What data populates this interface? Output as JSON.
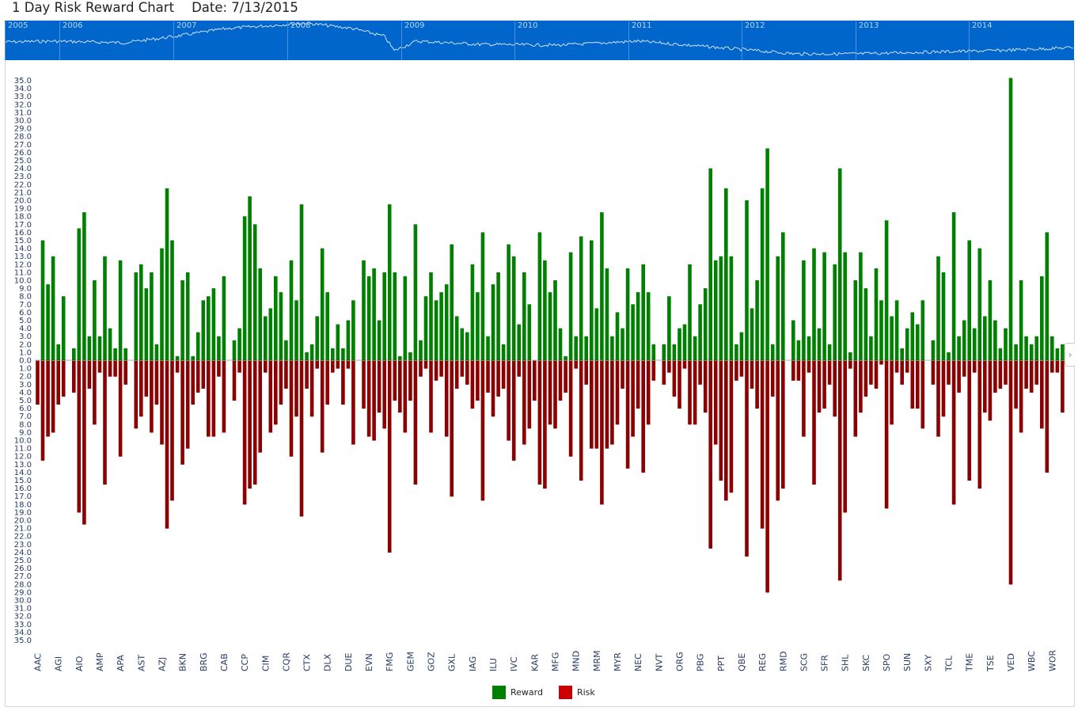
{
  "header": {
    "title": "1 Day Risk Reward Chart",
    "date_label": "Date: 7/13/2015"
  },
  "navigator": {
    "years": [
      "2005",
      "2006",
      "2007",
      "2008",
      "2009",
      "2010",
      "2011",
      "2012",
      "2013",
      "2014"
    ],
    "background_color": "#0066cc"
  },
  "colors": {
    "reward": "#008000",
    "risk": "#8b0000",
    "risk_legend": "#cc0000",
    "zero_line": "#cccccc"
  },
  "chart_data": {
    "type": "bar",
    "ylim": [
      -35,
      35
    ],
    "y_tick_step": 1,
    "y_tick_labels_absolute": true,
    "grid": false,
    "legend_position": "bottom",
    "x_tick_labels": [
      "AAC",
      "AGI",
      "AIO",
      "AMP",
      "APA",
      "AST",
      "AZJ",
      "BKN",
      "BRG",
      "CAB",
      "CCP",
      "CIM",
      "CQR",
      "CTX",
      "DLX",
      "DUE",
      "EVN",
      "FMG",
      "GEM",
      "GOZ",
      "GXL",
      "IAG",
      "ILU",
      "IVC",
      "KAR",
      "MFG",
      "MND",
      "MRM",
      "MYR",
      "NEC",
      "NVT",
      "ORG",
      "PBG",
      "PPT",
      "QBE",
      "REG",
      "RMD",
      "SCG",
      "SFR",
      "SHL",
      "SKC",
      "SPO",
      "SUN",
      "SXY",
      "TCL",
      "TME",
      "TSE",
      "VED",
      "WBC",
      "WOR"
    ],
    "series": [
      {
        "name": "Reward",
        "direction": "up",
        "values": [
          0,
          15,
          9.5,
          13,
          2,
          8,
          0,
          1.5,
          16.5,
          18.5,
          3,
          10,
          3,
          13,
          4,
          1.5,
          12.5,
          1.5,
          0,
          11,
          12,
          9,
          11,
          2,
          14,
          21.5,
          15,
          0.5,
          10,
          11,
          0.5,
          3.5,
          7.5,
          8,
          9,
          3,
          10.5,
          0,
          2.5,
          4,
          18,
          20.5,
          17,
          11.5,
          5.5,
          6.5,
          10.5,
          8.5,
          2.5,
          12.5,
          7.5,
          19.5,
          1,
          2,
          5.5,
          14,
          8.5,
          1.5,
          4.5,
          1.5,
          5,
          7.5,
          0,
          12.5,
          10.5,
          11.5,
          5,
          11,
          19.5,
          11,
          0.5,
          10.5,
          1,
          17,
          2.5,
          8,
          11,
          7.5,
          8.5,
          9.5,
          14.5,
          5.5,
          4,
          3.5,
          12,
          8.5,
          16,
          3,
          9.5,
          11,
          2,
          14.5,
          13,
          4.5,
          11,
          7,
          0,
          16,
          12.5,
          8.5,
          10,
          4,
          0.5,
          13.5,
          3,
          15.5,
          3,
          15,
          6.5,
          18.5,
          11.5,
          3,
          6,
          4,
          11.5,
          7,
          8.5,
          12,
          8.5,
          2,
          0,
          2,
          8,
          2,
          4,
          4.5,
          12,
          3,
          7,
          9,
          24,
          12.5,
          13,
          21.5,
          13,
          2,
          3.5,
          20,
          6.5,
          10,
          21.5,
          26.5,
          2,
          13,
          16,
          0,
          5,
          2.5,
          12.5,
          3,
          14,
          4,
          13.5,
          2,
          12,
          24,
          13.5,
          1,
          10,
          13.5,
          9,
          3,
          11.5,
          7.5,
          17.5,
          5.5,
          7.5,
          1.5,
          4,
          6,
          4.5,
          7.5,
          0,
          2.5,
          13,
          11,
          1,
          18.5,
          3,
          5,
          15,
          4,
          14,
          5.5,
          10,
          5,
          1.5,
          4,
          35.3,
          2,
          10,
          3,
          2,
          3,
          10.5,
          16,
          3,
          1.5,
          2
        ]
      },
      {
        "name": "Risk",
        "direction": "down",
        "values": [
          5.5,
          12.5,
          9.5,
          9,
          5.5,
          4.5,
          0,
          4,
          19,
          20.5,
          3.5,
          8,
          1.5,
          15.5,
          2,
          2,
          12,
          3,
          0,
          8.5,
          7,
          4.5,
          9,
          5.5,
          10.5,
          21,
          17.5,
          1.5,
          13,
          11,
          5.5,
          4,
          3.5,
          9.5,
          9.5,
          2,
          9,
          0,
          5,
          1.5,
          18,
          16,
          15.5,
          11.5,
          1.5,
          9,
          8,
          5.5,
          3.5,
          12,
          7,
          19.5,
          3.5,
          7,
          1,
          11.5,
          5.5,
          1.5,
          1,
          5.5,
          1,
          10.5,
          0,
          6,
          9.5,
          10,
          6.5,
          8.5,
          24,
          5,
          6.5,
          9,
          5,
          15.5,
          2,
          1,
          9,
          2.5,
          2,
          9.5,
          17,
          3.5,
          2,
          3,
          6,
          5,
          17.5,
          4,
          7,
          4.5,
          3.5,
          10,
          12.5,
          2,
          10.5,
          8.5,
          5,
          15.5,
          16,
          8,
          8.5,
          5,
          4,
          12,
          1,
          15,
          3,
          11,
          11,
          18,
          11,
          10.5,
          8,
          3.5,
          13.5,
          9.5,
          6,
          14,
          8,
          2.5,
          0,
          3,
          1.5,
          4.5,
          6,
          1,
          8,
          8,
          3,
          6.5,
          23.5,
          10.5,
          15,
          17.5,
          16.5,
          2.5,
          2,
          24.5,
          3.5,
          6,
          21,
          29,
          4.5,
          17.5,
          16,
          0,
          2.5,
          2.5,
          9.5,
          1.5,
          15.5,
          6.5,
          6,
          3,
          7,
          27.5,
          19,
          1,
          9.5,
          6.5,
          4.5,
          3,
          3.5,
          0.5,
          18.5,
          8,
          1.5,
          3,
          1.5,
          6,
          6,
          8.5,
          0,
          3,
          9.5,
          7,
          3,
          18,
          4,
          2,
          15,
          1.5,
          16,
          6.5,
          7.5,
          4,
          3.5,
          3,
          28,
          6,
          9,
          3.5,
          4,
          3,
          8.5,
          14,
          1.5,
          1.5,
          6.5
        ]
      }
    ]
  },
  "legend": {
    "reward_label": "Reward",
    "risk_label": "Risk"
  },
  "controls": {
    "scroll_right_icon": "chevron-right-icon"
  }
}
